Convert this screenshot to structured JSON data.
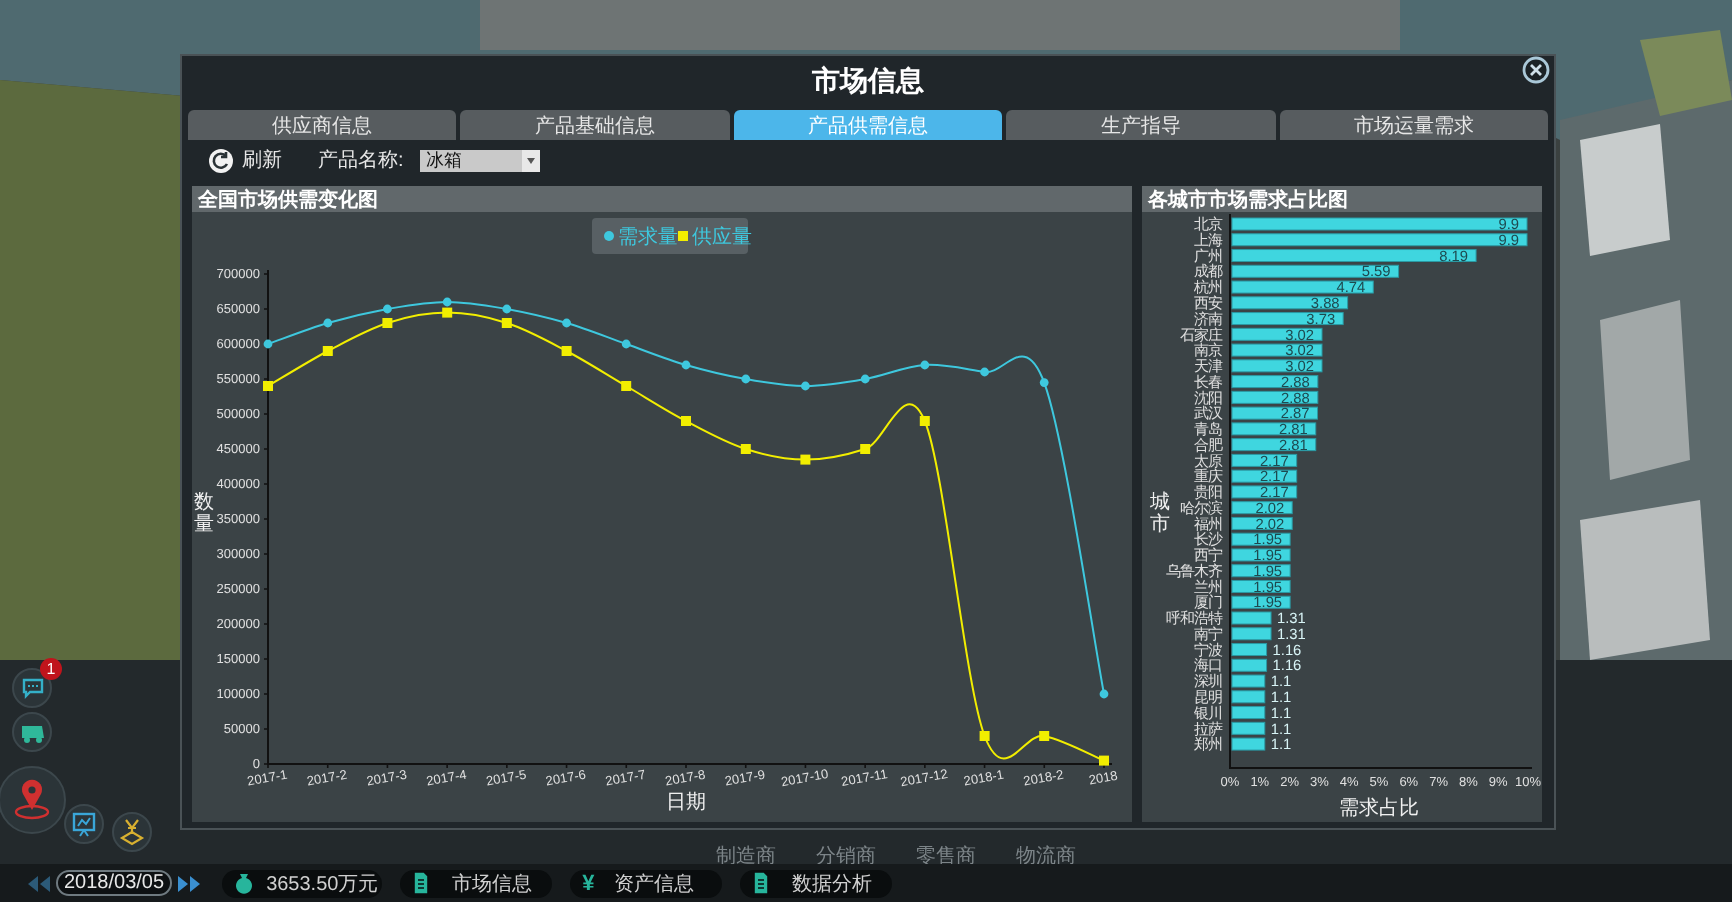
{
  "window": {
    "title": "市场信息"
  },
  "tabs": [
    {
      "label": "供应商信息",
      "selected": false
    },
    {
      "label": "产品基础信息",
      "selected": false
    },
    {
      "label": "产品供需信息",
      "selected": true
    },
    {
      "label": "生产指导",
      "selected": false
    },
    {
      "label": "市场运量需求",
      "selected": false
    }
  ],
  "toolbar": {
    "refresh_label": "刷新",
    "product_label": "产品名称:",
    "product_value": "冰箱"
  },
  "charts": [
    {
      "chart_data": {
        "type": "line",
        "title": "全国市场供需变化图",
        "xlabel": "日期",
        "ylabel": "数量",
        "categories": [
          "2017-1",
          "2017-2",
          "2017-3",
          "2017-4",
          "2017-5",
          "2017-6",
          "2017-7",
          "2017-8",
          "2017-9",
          "2017-10",
          "2017-11",
          "2017-12",
          "2018-1",
          "2018-2",
          "2018"
        ],
        "series": [
          {
            "name": "需求量",
            "color": "#3ec8de",
            "marker": "circle",
            "values": [
              600000,
              630000,
              650000,
              660000,
              650000,
              630000,
              600000,
              570000,
              550000,
              540000,
              550000,
              570000,
              560000,
              545000,
              100000
            ]
          },
          {
            "name": "供应量",
            "color": "#f2ee00",
            "marker": "square",
            "values": [
              540000,
              590000,
              630000,
              645000,
              630000,
              590000,
              540000,
              490000,
              450000,
              435000,
              450000,
              490000,
              40000,
              40000,
              5000
            ]
          }
        ],
        "ylim": [
          0,
          700000
        ],
        "legend": "top",
        "yticks": [
          0,
          50000,
          100000,
          150000,
          200000,
          250000,
          300000,
          350000,
          400000,
          450000,
          500000,
          550000,
          600000,
          650000,
          700000
        ]
      }
    },
    {
      "chart_data": {
        "type": "bar",
        "orientation": "horizontal",
        "title": "各城市市场需求占比图",
        "xlabel": "需求占比",
        "ylabel": "城市",
        "categories": [
          "北京",
          "上海",
          "广州",
          "成都",
          "杭州",
          "西安",
          "济南",
          "石家庄",
          "南京",
          "天津",
          "长春",
          "沈阳",
          "武汉",
          "青岛",
          "合肥",
          "太原",
          "重庆",
          "贵阳",
          "哈尔滨",
          "福州",
          "长沙",
          "西宁",
          "乌鲁木齐",
          "兰州",
          "厦门",
          "呼和浩特",
          "南宁",
          "宁波",
          "海口",
          "深圳",
          "昆明",
          "银川",
          "拉萨",
          "郑州"
        ],
        "series": [
          {
            "color": "#3fd6df",
            "values": [
              9.9,
              9.9,
              8.19,
              5.59,
              4.74,
              3.88,
              3.73,
              3.02,
              3.02,
              3.02,
              2.88,
              2.88,
              2.87,
              2.81,
              2.81,
              2.17,
              2.17,
              2.17,
              2.02,
              2.02,
              1.95,
              1.95,
              1.95,
              1.95,
              1.95,
              1.31,
              1.31,
              1.16,
              1.16,
              1.1,
              1.1,
              1.1,
              1.1,
              1.1
            ]
          }
        ],
        "xlim": [
          0,
          10
        ],
        "xticks": [
          {
            "value": 0,
            "label": "0%"
          },
          {
            "value": 1,
            "label": "1%"
          },
          {
            "value": 2,
            "label": "2%"
          },
          {
            "value": 3,
            "label": "3%"
          },
          {
            "value": 4,
            "label": "4%"
          },
          {
            "value": 5,
            "label": "5%"
          },
          {
            "value": 6,
            "label": "6%"
          },
          {
            "value": 7,
            "label": "7%"
          },
          {
            "value": 8,
            "label": "8%"
          },
          {
            "value": 9,
            "label": "9%"
          },
          {
            "value": 10,
            "label": "10%"
          }
        ],
        "data_labels": true
      }
    }
  ],
  "background_labels": [
    "制造商",
    "分销商",
    "零售商",
    "物流商"
  ],
  "side_buttons": {
    "badge": "1"
  },
  "bottom_bar": {
    "date": "2018/03/05",
    "items": [
      {
        "kind": "money",
        "label": "3653.50万元"
      },
      {
        "kind": "doc",
        "label": "市场信息"
      },
      {
        "kind": "yen",
        "glyph": "¥",
        "label": "资产信息"
      },
      {
        "kind": "doc",
        "label": "数据分析"
      }
    ]
  }
}
